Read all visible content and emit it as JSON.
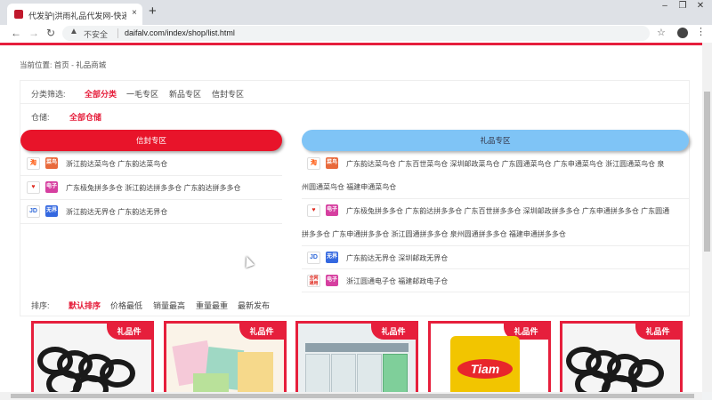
{
  "browser": {
    "tab_title": "代发驴|洪雨礼品代发网-快递单号",
    "tab_close": "×",
    "new_tab": "+",
    "insecure_label": "不安全",
    "url": "daifalv.com/index/shop/list.html",
    "icons": [
      "back-icon",
      "forward-icon",
      "reload-icon",
      "warning-icon",
      "star-icon",
      "account-icon",
      "menu-icon"
    ]
  },
  "breadcrumb": "当前位置:  首页 - 礼品商城",
  "filter": {
    "category_label": "分类筛选:",
    "categories": [
      "全部分类",
      "一毛专区",
      "新品专区",
      "信封专区"
    ],
    "warehouse_label": "仓储:",
    "warehouse_value": "全部仓储"
  },
  "left": {
    "banner": "信封专区",
    "rows": [
      {
        "icons": [
          "淘",
          "菜鸟"
        ],
        "text": "浙江韵达菜鸟仓   广东韵达菜鸟仓"
      },
      {
        "icons": [
          "♥",
          "电子"
        ],
        "text": "广东极兔拼多多仓   浙江韵达拼多多仓   广东韵达拼多多仓"
      },
      {
        "icons": [
          "JD",
          "无界"
        ],
        "text": "浙江韵达无界仓   广东韵达无界仓"
      }
    ]
  },
  "right": {
    "banner": "礼品专区",
    "rows": [
      {
        "icons": [
          "淘",
          "菜鸟"
        ],
        "line1": "广东韵达菜鸟仓   广东百世菜鸟仓   深圳邮政菜鸟仓   广东圆通菜鸟仓   广东申通菜鸟仓   浙江圆通菜鸟仓   泉",
        "line2": "州圆通菜鸟仓   福建申通菜鸟仓"
      },
      {
        "icons": [
          "♥",
          "电子"
        ],
        "line1": "广东极兔拼多多仓   广东韵达拼多多仓   广东百世拼多多仓   深圳邮政拼多多仓   广东申通拼多多仓   广东圆通",
        "line2": "拼多多仓   广东申通拼多多仓   浙江圆通拼多多仓   泉州圆通拼多多仓   福建申通拼多多仓"
      },
      {
        "icons": [
          "JD",
          "无界"
        ],
        "line1": "广东韵达无界仓   深圳邮政无界仓"
      },
      {
        "icons": [
          "全网通用",
          "电子"
        ],
        "line1": "浙江圆通电子仓   福建邮政电子仓"
      }
    ]
  },
  "sort": {
    "label": "排序:",
    "options": [
      "默认排序",
      "价格最低",
      "销量最高",
      "重量最重",
      "最新发布"
    ]
  },
  "products": {
    "badge": "礼品件",
    "brand_text": "Tiam"
  }
}
